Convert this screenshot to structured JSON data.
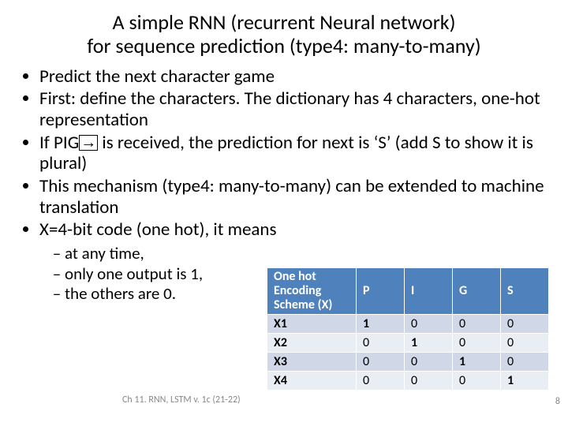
{
  "title_line1": "A simple RNN (recurrent Neural network)",
  "title_line2": "for sequence prediction (type4: many-to-many)",
  "bullets": {
    "b1": "Predict the next character game",
    "b2": "First: define the characters. The dictionary has 4 characters, one-hot representation",
    "b3a": "If PIG",
    "b3b": " is received, the prediction for next is ‘S’ (add S to show it is plural)",
    "b4": "This mechanism (type4: many-to-many) can be extended to machine translation",
    "b5": "X=4-bit code (one hot), it means"
  },
  "sub": {
    "s1": "at any time,",
    "s2": "only one output is 1,",
    "s3": "the others are 0."
  },
  "table": {
    "head0": "One hot Encoding Scheme (X)",
    "headP": "P",
    "headI": "I",
    "headG": "G",
    "headS": "S",
    "rows": [
      {
        "label": "X1",
        "v": [
          "1",
          "0",
          "0",
          "0"
        ]
      },
      {
        "label": "X2",
        "v": [
          "0",
          "1",
          "0",
          "0"
        ]
      },
      {
        "label": "X3",
        "v": [
          "0",
          "0",
          "1",
          "0"
        ]
      },
      {
        "label": "X4",
        "v": [
          "0",
          "0",
          "0",
          "1"
        ]
      }
    ]
  },
  "footer": "Ch 11. RNN, LSTM v. 1c (21-22)",
  "page": "8",
  "chart_data": {
    "type": "table",
    "title": "One hot Encoding Scheme (X)",
    "columns": [
      "P",
      "I",
      "G",
      "S"
    ],
    "rows": [
      "X1",
      "X2",
      "X3",
      "X4"
    ],
    "values": [
      [
        1,
        0,
        0,
        0
      ],
      [
        0,
        1,
        0,
        0
      ],
      [
        0,
        0,
        1,
        0
      ],
      [
        0,
        0,
        0,
        1
      ]
    ]
  }
}
